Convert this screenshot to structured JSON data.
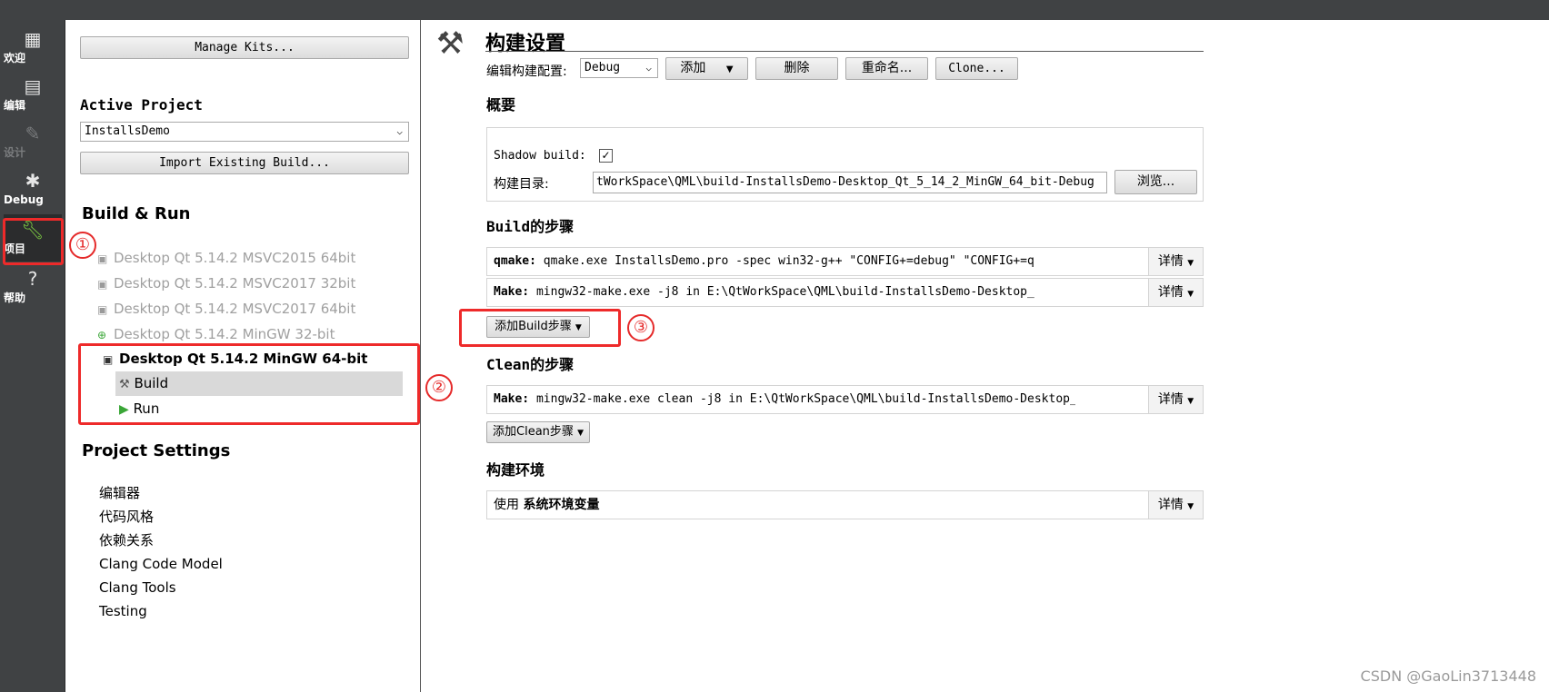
{
  "modebar": {
    "items": [
      {
        "label": "欢迎",
        "icon": "grid-icon"
      },
      {
        "label": "编辑",
        "icon": "document-icon"
      },
      {
        "label": "设计",
        "icon": "pencil-icon"
      },
      {
        "label": "Debug",
        "icon": "bug-icon"
      },
      {
        "label": "项目",
        "icon": "wrench-icon"
      },
      {
        "label": "帮助",
        "icon": "question-icon"
      }
    ]
  },
  "sidebar": {
    "manage_kits": "Manage Kits...",
    "active_project_title": "Active Project",
    "active_project_value": "InstallsDemo",
    "import_build": "Import Existing Build...",
    "build_run_title": "Build & Run",
    "kits": [
      "Desktop Qt 5.14.2 MSVC2015 64bit",
      "Desktop Qt 5.14.2 MSVC2017 32bit",
      "Desktop Qt 5.14.2 MSVC2017 64bit",
      "Desktop Qt 5.14.2 MinGW 32-bit",
      "Desktop Qt 5.14.2 MinGW 64-bit"
    ],
    "build_label": "Build",
    "run_label": "Run",
    "project_settings_title": "Project Settings",
    "settings": [
      "编辑器",
      "代码风格",
      "依赖关系",
      "Clang Code Model",
      "Clang Tools",
      "Testing"
    ]
  },
  "annotations": [
    "①",
    "②",
    "③"
  ],
  "main": {
    "title": "构建设置",
    "edit_config_label": "编辑构建配置:",
    "config_value": "Debug",
    "add": "添加",
    "delete": "删除",
    "rename": "重命名...",
    "clone": "Clone...",
    "overview_title": "概要",
    "shadow_build_label": "Shadow build:",
    "shadow_checked": "✓",
    "build_dir_label": "构建目录:",
    "build_dir_value": "tWorkSpace\\QML\\build-InstallsDemo-Desktop_Qt_5_14_2_MinGW_64_bit-Debug",
    "browse": "浏览...",
    "build_steps_title": "Build的步骤",
    "build_steps": [
      {
        "name": "qmake:",
        "command": "qmake.exe InstallsDemo.pro -spec win32-g++ \"CONFIG+=debug\" \"CONFIG+=q"
      },
      {
        "name": "Make:",
        "command": "mingw32-make.exe -j8 in E:\\QtWorkSpace\\QML\\build-InstallsDemo-Desktop_"
      }
    ],
    "add_build_step": "添加Build步骤",
    "clean_steps_title": "Clean的步骤",
    "clean_steps": [
      {
        "name": "Make:",
        "command": "mingw32-make.exe clean -j8 in E:\\QtWorkSpace\\QML\\build-InstallsDemo-Desktop_"
      }
    ],
    "add_clean_step": "添加Clean步骤",
    "env_title": "构建环境",
    "env_use": "使用",
    "env_value": "系统环境变量",
    "details": "详情"
  },
  "watermark": "CSDN @GaoLin3713448"
}
